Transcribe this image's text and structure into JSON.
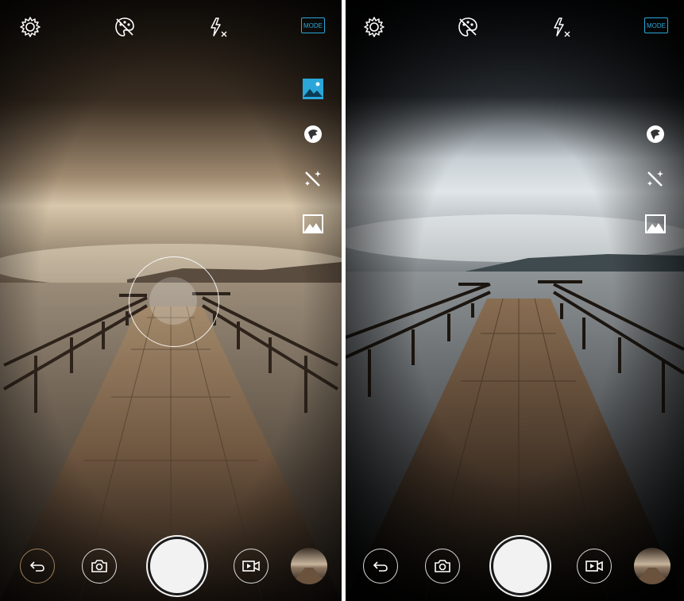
{
  "screens": [
    {
      "id": "left",
      "top_bar": {
        "settings_icon": "gear-icon",
        "filter_icon": "palette-off-icon",
        "flash_icon": "flash-off-icon",
        "mode_label": "MODE"
      },
      "side_tools": [
        "landscape-mode-icon",
        "portrait-beauty-icon",
        "magic-wand-icon",
        "panorama-icon"
      ],
      "side_tools_active": "landscape-mode-icon",
      "focus_indicator_visible": true,
      "bottom_bar": [
        "back-icon",
        "camera-icon",
        "shutter",
        "video-icon",
        "gallery-thumbnail"
      ],
      "colors": {
        "accent": "#2aa7d8",
        "tint": "sepia"
      }
    },
    {
      "id": "right",
      "top_bar": {
        "settings_icon": "gear-icon",
        "filter_icon": "palette-off-icon",
        "flash_icon": "flash-off-icon",
        "mode_label": "MODE"
      },
      "side_tools": [
        "portrait-beauty-icon",
        "magic-wand-icon",
        "panorama-icon"
      ],
      "focus_indicator_visible": false,
      "bottom_bar": [
        "back-icon",
        "camera-icon",
        "shutter",
        "video-icon",
        "gallery-thumbnail"
      ],
      "colors": {
        "accent": "#2aa7d8",
        "tint": "blue-grey"
      }
    }
  ]
}
